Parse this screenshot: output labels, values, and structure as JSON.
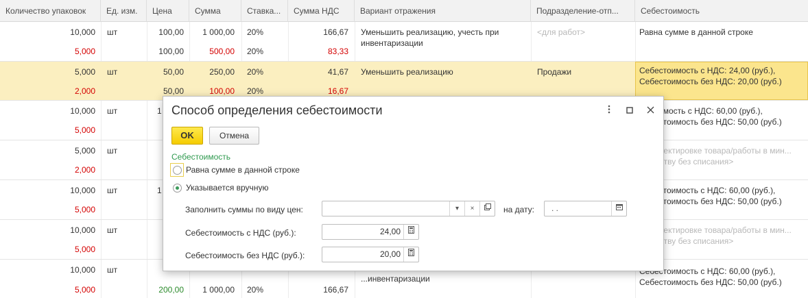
{
  "table": {
    "headers": [
      "Количество упаковок",
      "Ед. изм.",
      "Цена",
      "Сумма",
      "Ставка...",
      "Сумма НДС",
      "Вариант отражения",
      "Подразделение-отп...",
      "Себестоимость"
    ],
    "rows": [
      {
        "qty": "10,000",
        "qty2": "5,000",
        "unit": "шт",
        "price": "100,00",
        "price2": "100,00",
        "sum": "1 000,00",
        "sum2": "500,00",
        "rate": "20%",
        "rate2": "20%",
        "vat": "166,67",
        "vat2": "83,33",
        "variant": "Уменьшить реализацию, учесть при инвентаризации",
        "dept": "<для работ>",
        "cost": "Равна сумме в данной строке"
      },
      {
        "qty": "5,000",
        "qty2": "2,000",
        "unit": "шт",
        "price": "50,00",
        "price2": "50,00",
        "sum": "250,00",
        "sum2": "100,00",
        "rate": "20%",
        "rate2": "20%",
        "vat": "41,67",
        "vat2": "16,67",
        "variant": "Уменьшить реализацию",
        "dept": "Продажи",
        "cost": "Себестоимость с НДС: 24,00 (руб.), Себестоимость без НДС: 20,00 (руб.)"
      },
      {
        "qty": "10,000",
        "qty2": "5,000",
        "unit": "шт",
        "price": "1",
        "cost": "...стоимость с НДС: 60,00 (руб.), Себестоимость без НДС: 50,00 (руб.)"
      },
      {
        "qty": "5,000",
        "qty2": "2,000",
        "unit": "шт",
        "cost": "...корректировке товара/работы в мин... ...ичеству без списания>"
      },
      {
        "qty": "10,000",
        "qty2": "5,000",
        "unit": "шт",
        "price": "1",
        "cost": "Себестоимость с НДС: 60,00 (руб.), Себестоимость без НДС: 50,00 (руб.)"
      },
      {
        "qty": "10,000",
        "qty2": "5,000",
        "unit": "шт",
        "cost": "...корректировке товара/работы в мин... ...ичеству без списания>"
      },
      {
        "qty": "10,000",
        "qty2": "5,000",
        "unit": "шт",
        "price2": "200,00",
        "sum2": "1 000,00",
        "rate2": "20%",
        "vat2": "166,67",
        "variant": "...инвентаризации",
        "cost": "Себестоимость с НДС: 60,00 (руб.), Себестоимость без НДС: 50,00 (руб.)"
      }
    ]
  },
  "dialog": {
    "title": "Способ определения себестоимости",
    "ok_label": "OK",
    "cancel_label": "Отмена",
    "group_label": "Себестоимость",
    "option1": "Равна сумме в данной строке",
    "option2": "Указывается вручную",
    "fill_label": "Заполнить суммы по виду цен:",
    "fill_value": "",
    "date_label": "на дату:",
    "date_value": " .  .",
    "cost_vat_label": "Себестоимость с НДС (руб.):",
    "cost_vat_value": "24,00",
    "cost_novat_label": "Себестоимость без НДС (руб.):",
    "cost_novat_value": "20,00",
    "selected_option": "option2"
  },
  "icons": {
    "menu": "more-vertical-icon",
    "maximize": "maximize-icon",
    "close": "close-icon",
    "dropdown": "chevron-down-icon",
    "clear": "clear-icon",
    "open": "open-icon",
    "calendar": "calendar-icon",
    "calculator": "calculator-icon"
  },
  "colors": {
    "ok_button": "#f5cc00",
    "selection_row": "#fbefc0",
    "selected_cell": "#fbe58d",
    "negative_text": "#d40000",
    "group_label": "#2f9a4f"
  }
}
